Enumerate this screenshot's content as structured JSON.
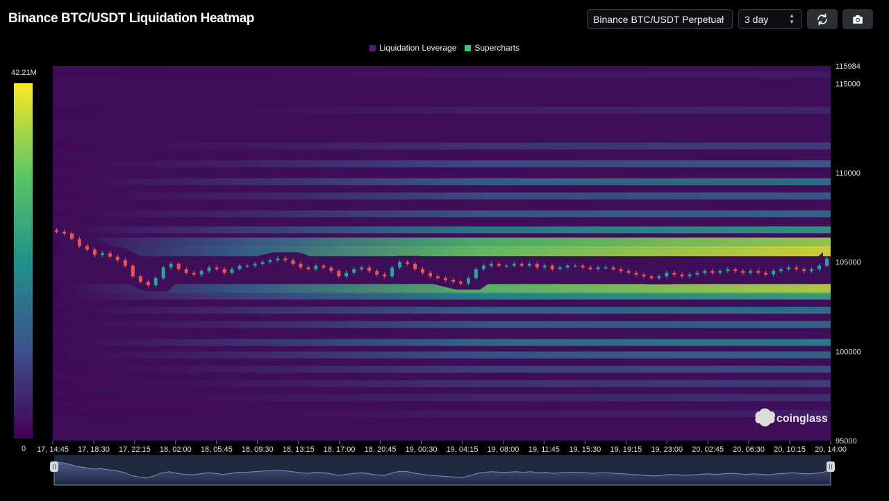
{
  "header": {
    "title": "Binance BTC/USDT Liquidation Heatmap",
    "pair_select": "Binance BTC/USDT Perpetual",
    "range_select": "3 day",
    "refresh_icon": "refresh-icon",
    "screenshot_icon": "camera-icon"
  },
  "legend": {
    "items": [
      {
        "label": "Liquidation Leverage",
        "color": "#5a1a78"
      },
      {
        "label": "Supercharts",
        "color": "#2ecc71"
      }
    ]
  },
  "colorbar": {
    "max_label": "42.21M",
    "min_label": "0"
  },
  "watermark": "coinglass",
  "colors": {
    "up": "#26a69a",
    "down": "#ef5350",
    "background": "#000000"
  },
  "chart_data": {
    "type": "heatmap",
    "title": "Binance BTC/USDT Liquidation Heatmap",
    "x_tick_labels": [
      "17, 14:45",
      "17, 18:30",
      "17, 22:15",
      "18, 02:00",
      "18, 05:45",
      "18, 09:30",
      "18, 13:15",
      "18, 17:00",
      "18, 20:45",
      "19, 00:30",
      "19, 04:15",
      "19, 08:00",
      "19, 11:45",
      "19, 15:30",
      "19, 19:15",
      "19, 23:00",
      "20, 02:45",
      "20, 06:30",
      "20, 10:15",
      "20, 14:00"
    ],
    "y_tick_labels": [
      "115984",
      "115000",
      "110000",
      "105000",
      "100000",
      "95000"
    ],
    "ylim": [
      95000,
      115984
    ],
    "colorscale_range": [
      0,
      42210000
    ],
    "colorbar_unit": "M",
    "bands": [
      {
        "price": 115500,
        "intensity": 0.08
      },
      {
        "price": 113500,
        "intensity": 0.12
      },
      {
        "price": 111500,
        "intensity": 0.2
      },
      {
        "price": 110500,
        "intensity": 0.3
      },
      {
        "price": 109500,
        "intensity": 0.4
      },
      {
        "price": 108700,
        "intensity": 0.3
      },
      {
        "price": 107700,
        "intensity": 0.35
      },
      {
        "price": 106800,
        "intensity": 0.55
      },
      {
        "price": 106100,
        "intensity": 0.85
      },
      {
        "price": 105600,
        "intensity": 0.95
      },
      {
        "price": 103500,
        "intensity": 0.9
      },
      {
        "price": 103100,
        "intensity": 0.6
      },
      {
        "price": 102300,
        "intensity": 0.4
      },
      {
        "price": 101500,
        "intensity": 0.35
      },
      {
        "price": 100500,
        "intensity": 0.45
      },
      {
        "price": 99800,
        "intensity": 0.35
      },
      {
        "price": 99000,
        "intensity": 0.25
      },
      {
        "price": 98200,
        "intensity": 0.2
      },
      {
        "price": 97400,
        "intensity": 0.15
      },
      {
        "price": 96500,
        "intensity": 0.1
      }
    ],
    "close_prices": [
      106700,
      106600,
      106300,
      105900,
      105700,
      105400,
      105500,
      105300,
      105100,
      104800,
      104200,
      103900,
      103700,
      104100,
      104700,
      104900,
      104600,
      104400,
      104300,
      104500,
      104700,
      104600,
      104400,
      104600,
      104800,
      104800,
      104900,
      105000,
      105100,
      105200,
      105100,
      104900,
      104700,
      104600,
      104800,
      104700,
      104500,
      104200,
      104400,
      104600,
      104700,
      104500,
      104300,
      104200,
      104700,
      105000,
      104900,
      104600,
      104400,
      104200,
      104100,
      104000,
      103900,
      103800,
      104100,
      104600,
      104800,
      104900,
      104800,
      104800,
      104900,
      104800,
      104900,
      104700,
      104800,
      104600,
      104700,
      104800,
      104800,
      104700,
      104600,
      104700,
      104700,
      104600,
      104500,
      104400,
      104300,
      104200,
      104100,
      104200,
      104400,
      104300,
      104200,
      104300,
      104400,
      104500,
      104400,
      104500,
      104600,
      104500,
      104400,
      104500,
      104400,
      104300,
      104500,
      104600,
      104700,
      104600,
      104500,
      104600,
      104800,
      105200
    ]
  },
  "navigator": {
    "shown": true
  }
}
